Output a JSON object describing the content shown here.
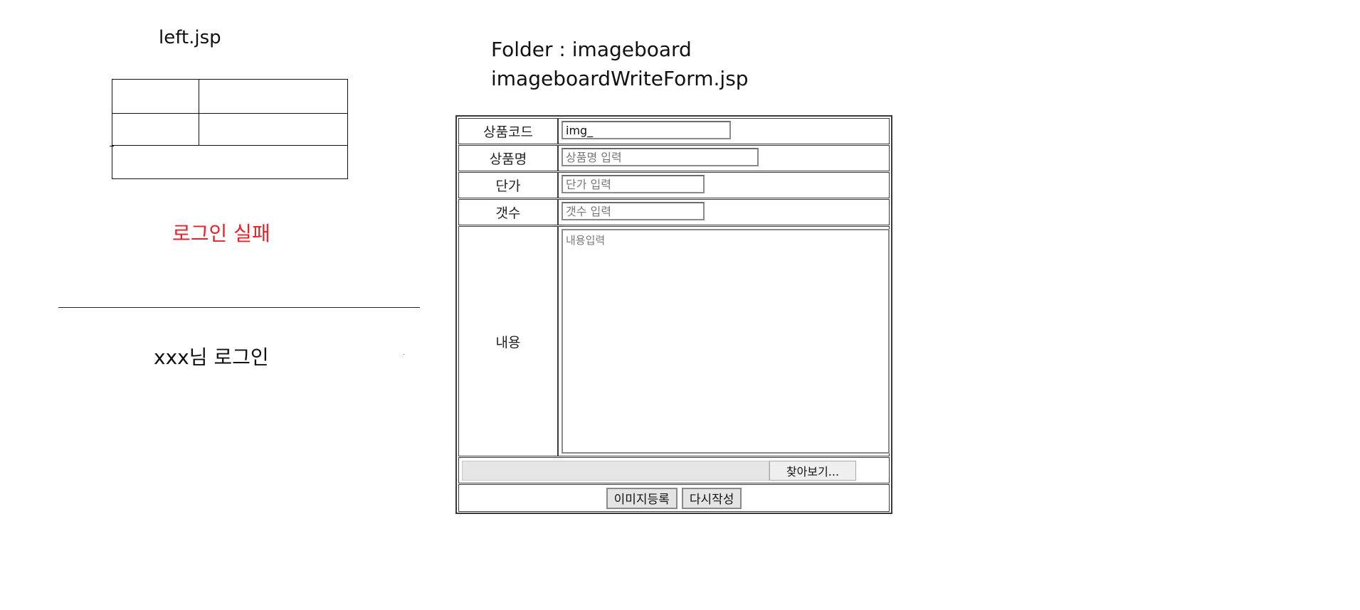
{
  "left": {
    "title": "left.jsp",
    "login_fail_text": "로그인 실패",
    "login_ok_text": "xxx님 로그인"
  },
  "right": {
    "folder_label": "Folder : imageboard",
    "file_label": "imageboardWriteForm.jsp"
  },
  "form": {
    "product_code": {
      "label": "상품코드",
      "value": "img_"
    },
    "product_name": {
      "label": "상품명",
      "placeholder": "상품명 입력"
    },
    "unit_price": {
      "label": "단가",
      "placeholder": "단가 입력"
    },
    "quantity": {
      "label": "갯수",
      "placeholder": "갯수 입력"
    },
    "content": {
      "label": "내용",
      "placeholder": "내용입력"
    },
    "file": {
      "browse_label": "찾아보기..."
    },
    "buttons": {
      "submit_label": "이미지등록",
      "reset_label": "다시작성"
    }
  },
  "colors": {
    "login_fail": "#e8212b",
    "border": "#3a3a3a"
  }
}
